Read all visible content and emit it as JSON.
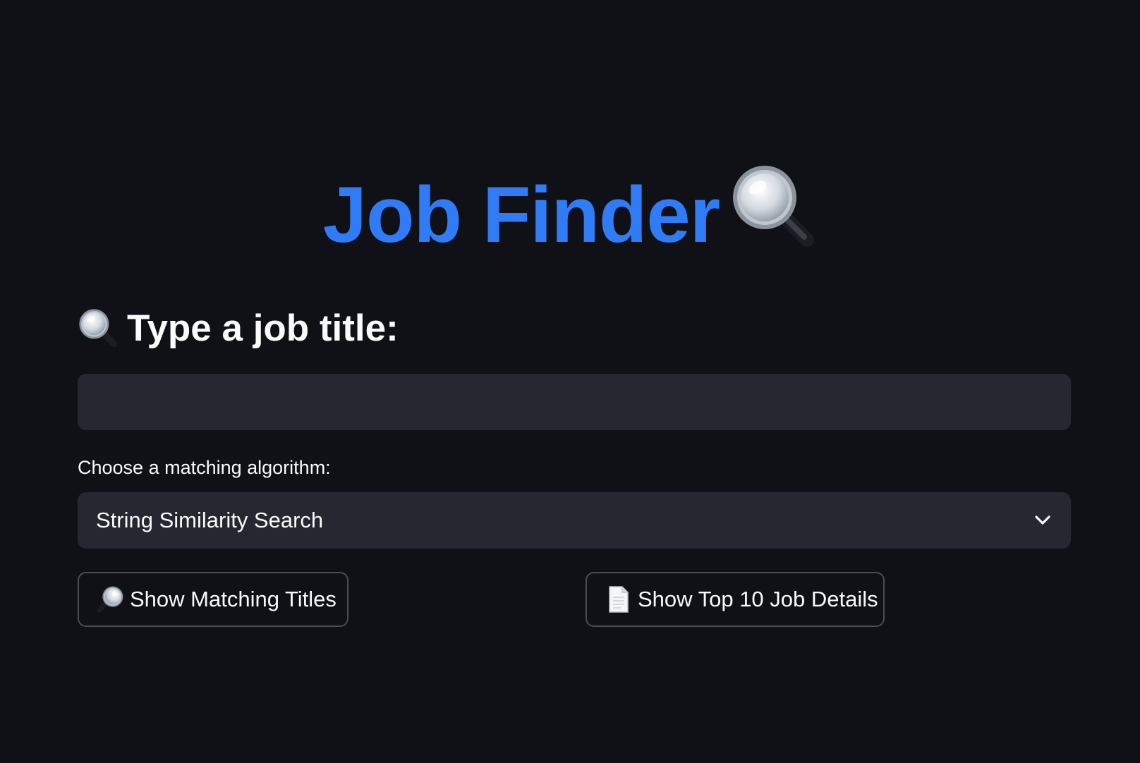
{
  "header": {
    "title": "Job Finder",
    "title_icon": "magnifying-glass-tilted-left"
  },
  "search": {
    "label": "Type a job title:",
    "label_icon": "magnifying-glass-tilted-left",
    "value": "",
    "placeholder": ""
  },
  "algorithm": {
    "label": "Choose a matching algorithm:",
    "selected": "String Similarity Search",
    "dropdown_icon": "chevron-down"
  },
  "buttons": {
    "matching_label": "Show Matching Titles",
    "matching_icon": "magnifying-glass-tilted-right",
    "details_label": "Show Top 10 Job Details",
    "details_icon": "page-document"
  },
  "colors": {
    "background": "#0f1117",
    "title_blue": "#2f7cf6",
    "input_bg": "#262730",
    "text": "#fafafa",
    "button_border": "#4a4c55"
  }
}
